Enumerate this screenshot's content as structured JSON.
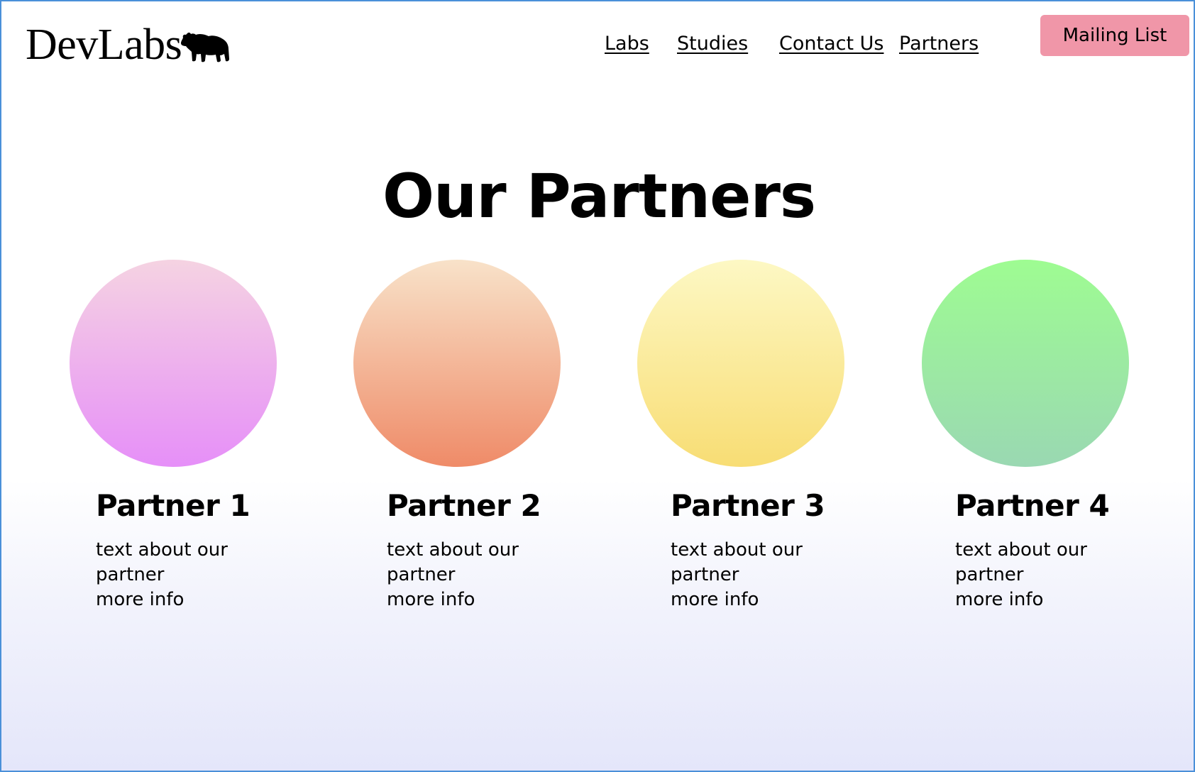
{
  "header": {
    "logo_text": "DevLabs",
    "logo_icon": "bear-icon",
    "nav": [
      {
        "label": "Labs"
      },
      {
        "label": "Studies"
      },
      {
        "label": "Contact Us"
      },
      {
        "label": "Partners"
      }
    ],
    "mailing_button": "Mailing List"
  },
  "main": {
    "title": "Our Partners",
    "partners": [
      {
        "name": "Partner 1",
        "description": "text about our partner",
        "more": "more info",
        "gradient": [
          "#f5d3e2",
          "#e68ff8"
        ]
      },
      {
        "name": "Partner 2",
        "description": "text about our partner",
        "more": "more info",
        "gradient": [
          "#f8e2c9",
          "#ef8b68"
        ]
      },
      {
        "name": "Partner 3",
        "description": "text about our partner",
        "more": "more info",
        "gradient": [
          "#fdf8c4",
          "#f8dd74"
        ]
      },
      {
        "name": "Partner 4",
        "description": "text about our partner",
        "more": "more info",
        "gradient": [
          "#9efc92",
          "#9ad8b2"
        ]
      }
    ]
  },
  "colors": {
    "accent_button": "#f096a8",
    "frame_border": "#4a90d9",
    "background_bottom": "#e4e6fa"
  }
}
